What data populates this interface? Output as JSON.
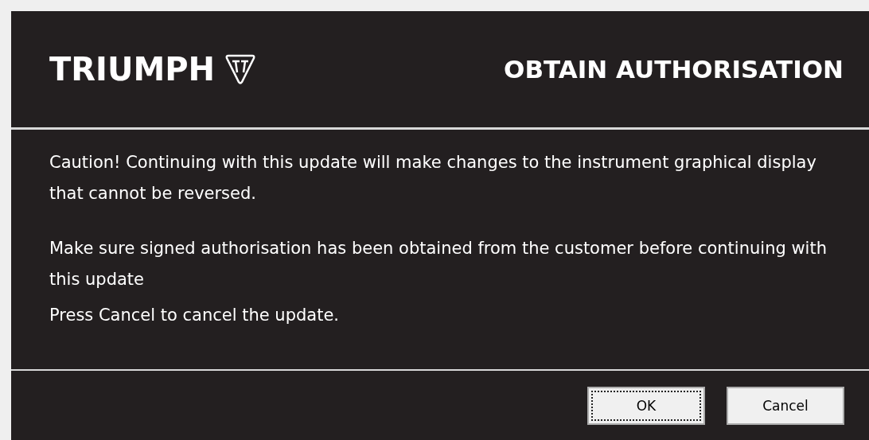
{
  "header": {
    "logo": "TRIUMPH",
    "title": "OBTAIN AUTHORISATION"
  },
  "message": [
    "Caution! Continuing with this update will make changes to the instrument graphical display that cannot be reversed.",
    "Make sure signed authorisation has been obtained from the customer before continuing with this update",
    "Press Cancel to cancel the update."
  ],
  "buttons": [
    {
      "label": "OK",
      "focused": true
    },
    {
      "label": "Cancel",
      "focused": false
    }
  ]
}
